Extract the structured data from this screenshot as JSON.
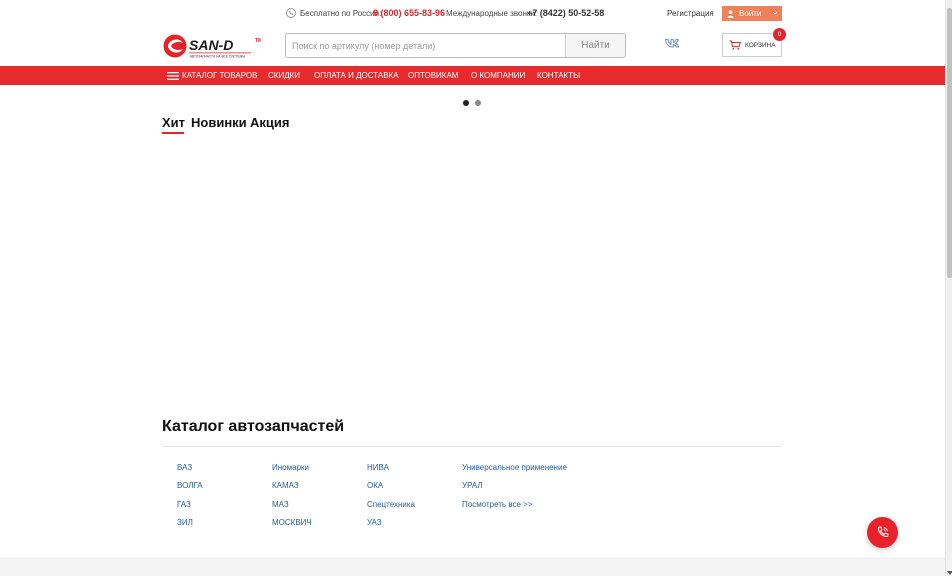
{
  "colors": {
    "accent": "#e62b2c",
    "phone": "#e32529",
    "login": "#f0805a",
    "link": "#1f5f9e",
    "vk": "#4a76a8"
  },
  "topline": {
    "free_label": "Бесплатно по России:",
    "free_phone": "8 (800) 655-83-96",
    "intl_label": "Международные звонки:",
    "intl_phone": "+7 (8422) 50-52-58",
    "register": "Регистрация",
    "login": "Войти"
  },
  "header": {
    "logo_text": "SAN-D",
    "logo_tagline": "АВТОЗАПЧАСТИ НА ВСЕ СИСТЕМЫ",
    "search_placeholder": "Поиск по артикулу (номер детали)",
    "search_button": "Найти",
    "cart_label": "КОРЗИНА",
    "cart_count": "0"
  },
  "nav": {
    "items": [
      "КАТАЛОГ ТОВАРОВ",
      "СКИДКИ",
      "ОПЛАТА И ДОСТАВКА",
      "ОПТОВИКАМ",
      "О КОМПАНИИ",
      "КОНТАКТЫ"
    ]
  },
  "slider": {
    "active_dot": 1,
    "dot_count": 2
  },
  "tabs": [
    "Хит",
    "Новинки",
    "Акция"
  ],
  "catalog": {
    "title": "Каталог автозапчастей",
    "columns": [
      [
        "ВАЗ",
        "ВОЛГА",
        "ГАЗ",
        "ЗИЛ"
      ],
      [
        "Иномарки",
        "КАМАЗ",
        "МАЗ",
        "МОСКВИЧ"
      ],
      [
        "НИВА",
        "ОКА",
        "Спецтехника",
        "УАЗ"
      ],
      [
        "Универсальное применение",
        "УРАЛ",
        "Посмотреть все >>"
      ]
    ]
  },
  "icons": {
    "phone": "phone-icon",
    "user": "user-icon",
    "vk": "vk-icon",
    "cart": "cart-icon",
    "menu": "burger-icon",
    "call": "call-icon"
  }
}
